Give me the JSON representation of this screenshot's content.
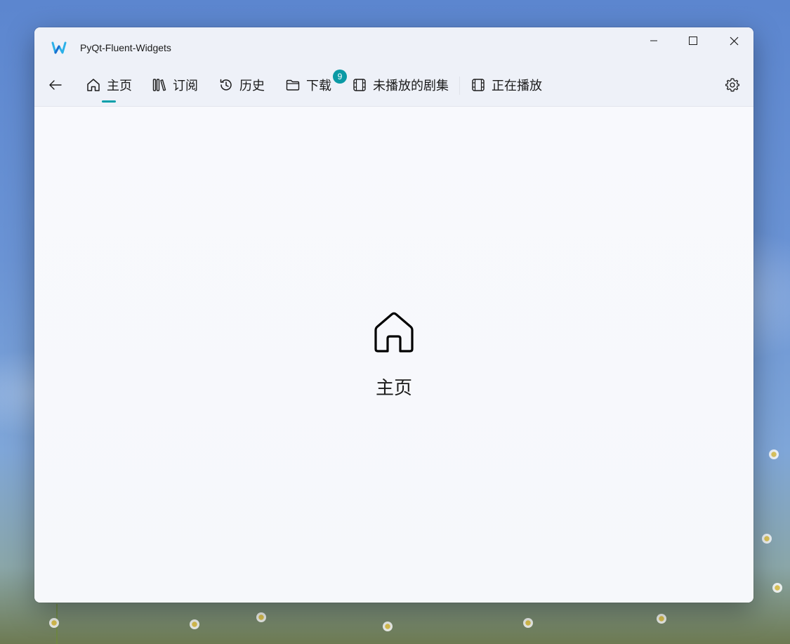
{
  "window": {
    "title": "PyQt-Fluent-Widgets"
  },
  "nav": {
    "items": [
      {
        "label": "主页",
        "icon": "home-icon",
        "selected": true
      },
      {
        "label": "订阅",
        "icon": "library-icon"
      },
      {
        "label": "历史",
        "icon": "history-icon"
      },
      {
        "label": "下载",
        "icon": "folder-icon",
        "badge": "9"
      },
      {
        "label": "未播放的剧集",
        "icon": "film-icon"
      },
      {
        "label": "正在播放",
        "icon": "film-icon"
      }
    ]
  },
  "content": {
    "title": "主页",
    "icon": "home-icon"
  },
  "colors": {
    "accent": "#009faa",
    "badge": "#0b9aa5"
  }
}
